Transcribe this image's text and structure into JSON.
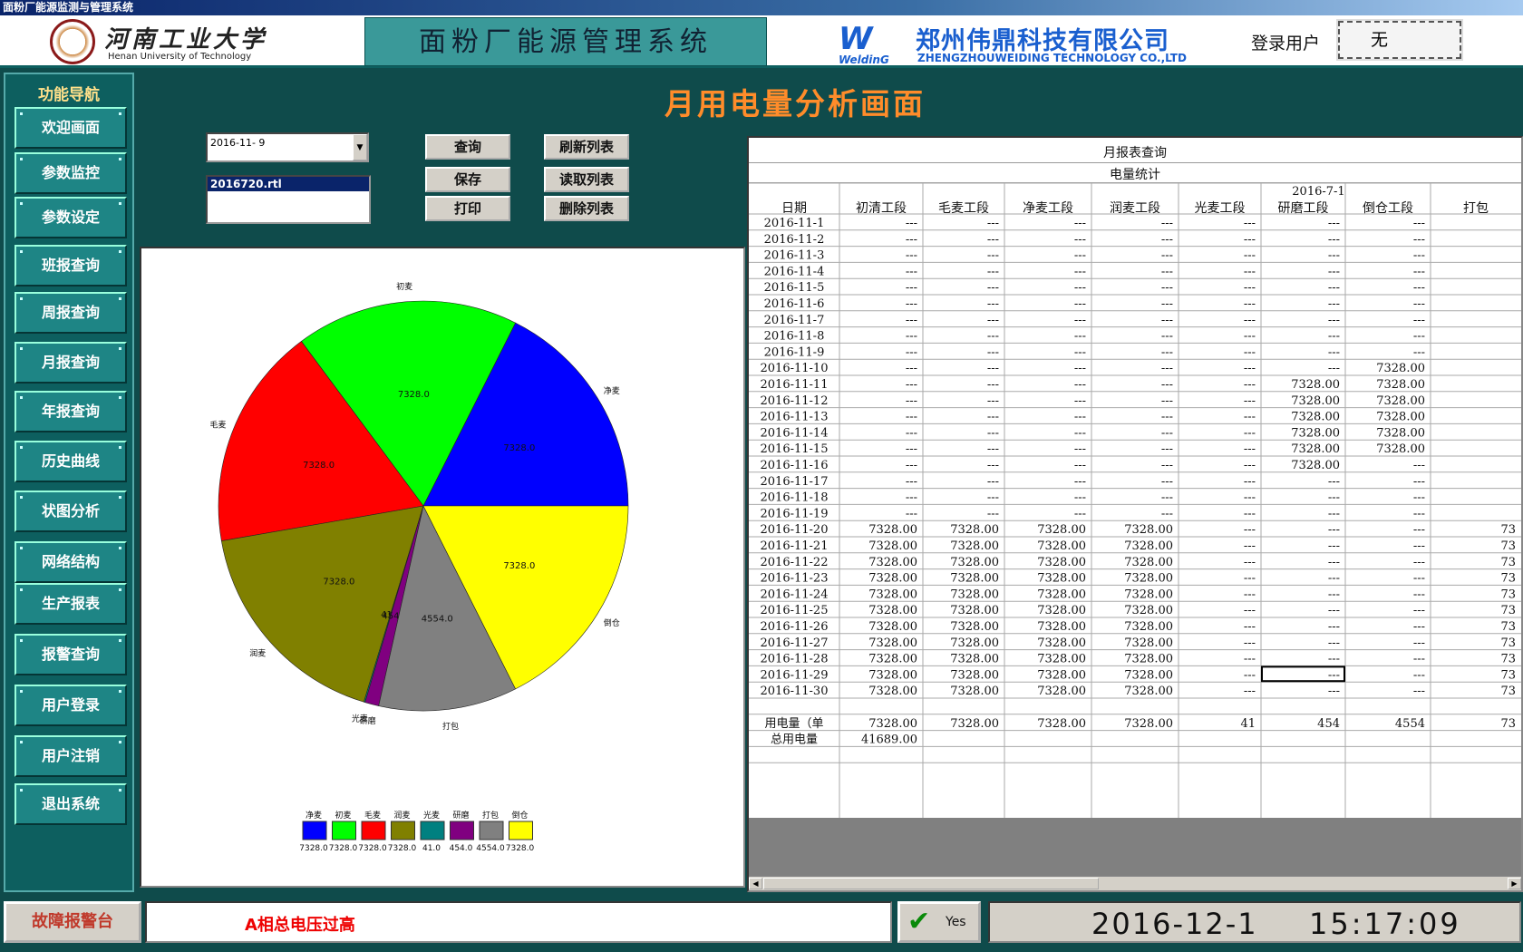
{
  "window_title": "面粉厂能源监测与管理系统",
  "header": {
    "univ_name": "河南工业大学",
    "univ_en": "Henan University of Technology",
    "system_title": "面粉厂能源管理系统",
    "company_logo_text": "WeldinG",
    "company_name": "郑州伟鼎科技有限公司",
    "company_en": "ZHENGZHOUWEIDING TECHNOLOGY CO.,LTD",
    "login_label": "登录用户",
    "login_user": "无"
  },
  "sidebar": {
    "title": "功能导航",
    "items": [
      {
        "label": "欢迎画面"
      },
      {
        "label": "参数监控"
      },
      {
        "label": "参数设定"
      },
      {
        "label": "班报查询"
      },
      {
        "label": "周报查询"
      },
      {
        "label": "月报查询"
      },
      {
        "label": "年报查询"
      },
      {
        "label": "历史曲线"
      },
      {
        "label": "状图分析"
      },
      {
        "label": "网络结构"
      },
      {
        "label": "生产报表"
      },
      {
        "label": "报警查询"
      },
      {
        "label": "用户登录"
      },
      {
        "label": "用户注销"
      },
      {
        "label": "退出系统"
      }
    ]
  },
  "main": {
    "page_title": "月用电量分析画面",
    "date_value": "2016-11- 9",
    "file_selected": "2016720.rtl",
    "buttons": {
      "query": "查询",
      "save": "保存",
      "print": "打印",
      "refresh": "刷新列表",
      "read": "读取列表",
      "delete": "删除列表"
    }
  },
  "chart_data": {
    "type": "pie",
    "categories": [
      "净麦",
      "初麦",
      "毛麦",
      "润麦",
      "光麦",
      "研磨",
      "打包",
      "倒仓"
    ],
    "values": [
      7328.0,
      7328.0,
      7328.0,
      7328.0,
      41.0,
      454.0,
      4554.0,
      7328.0
    ],
    "value_labels": [
      "7328.0",
      "7328.0",
      "7328.0",
      "7328.0",
      "41.0",
      "454.0",
      "4554.0",
      "7328.0"
    ],
    "colors": [
      "#0000ff",
      "#00ff00",
      "#ff0000",
      "#808000",
      "#008080",
      "#800080",
      "#808080",
      "#ffff00"
    ],
    "title": "",
    "legend": "bottom"
  },
  "report": {
    "title": "月报表查询",
    "subtitle": "电量统计",
    "period_label": "2016-7-1",
    "columns": [
      "日期",
      "初清工段",
      "毛麦工段",
      "净麦工段",
      "润麦工段",
      "光麦工段",
      "研磨工段",
      "倒仓工段",
      "打包"
    ],
    "rows": [
      [
        "2016-11-1",
        "---",
        "---",
        "---",
        "---",
        "---",
        "---",
        "---",
        ""
      ],
      [
        "2016-11-2",
        "---",
        "---",
        "---",
        "---",
        "---",
        "---",
        "---",
        ""
      ],
      [
        "2016-11-3",
        "---",
        "---",
        "---",
        "---",
        "---",
        "---",
        "---",
        ""
      ],
      [
        "2016-11-4",
        "---",
        "---",
        "---",
        "---",
        "---",
        "---",
        "---",
        ""
      ],
      [
        "2016-11-5",
        "---",
        "---",
        "---",
        "---",
        "---",
        "---",
        "---",
        ""
      ],
      [
        "2016-11-6",
        "---",
        "---",
        "---",
        "---",
        "---",
        "---",
        "---",
        ""
      ],
      [
        "2016-11-7",
        "---",
        "---",
        "---",
        "---",
        "---",
        "---",
        "---",
        ""
      ],
      [
        "2016-11-8",
        "---",
        "---",
        "---",
        "---",
        "---",
        "---",
        "---",
        ""
      ],
      [
        "2016-11-9",
        "---",
        "---",
        "---",
        "---",
        "---",
        "---",
        "---",
        ""
      ],
      [
        "2016-11-10",
        "---",
        "---",
        "---",
        "---",
        "---",
        "---",
        "7328.00",
        ""
      ],
      [
        "2016-11-11",
        "---",
        "---",
        "---",
        "---",
        "---",
        "7328.00",
        "7328.00",
        ""
      ],
      [
        "2016-11-12",
        "---",
        "---",
        "---",
        "---",
        "---",
        "7328.00",
        "7328.00",
        ""
      ],
      [
        "2016-11-13",
        "---",
        "---",
        "---",
        "---",
        "---",
        "7328.00",
        "7328.00",
        ""
      ],
      [
        "2016-11-14",
        "---",
        "---",
        "---",
        "---",
        "---",
        "7328.00",
        "7328.00",
        ""
      ],
      [
        "2016-11-15",
        "---",
        "---",
        "---",
        "---",
        "---",
        "7328.00",
        "7328.00",
        ""
      ],
      [
        "2016-11-16",
        "---",
        "---",
        "---",
        "---",
        "---",
        "7328.00",
        "---",
        ""
      ],
      [
        "2016-11-17",
        "---",
        "---",
        "---",
        "---",
        "---",
        "---",
        "---",
        ""
      ],
      [
        "2016-11-18",
        "---",
        "---",
        "---",
        "---",
        "---",
        "---",
        "---",
        ""
      ],
      [
        "2016-11-19",
        "---",
        "---",
        "---",
        "---",
        "---",
        "---",
        "---",
        ""
      ],
      [
        "2016-11-20",
        "7328.00",
        "7328.00",
        "7328.00",
        "7328.00",
        "---",
        "---",
        "---",
        "73"
      ],
      [
        "2016-11-21",
        "7328.00",
        "7328.00",
        "7328.00",
        "7328.00",
        "---",
        "---",
        "---",
        "73"
      ],
      [
        "2016-11-22",
        "7328.00",
        "7328.00",
        "7328.00",
        "7328.00",
        "---",
        "---",
        "---",
        "73"
      ],
      [
        "2016-11-23",
        "7328.00",
        "7328.00",
        "7328.00",
        "7328.00",
        "---",
        "---",
        "---",
        "73"
      ],
      [
        "2016-11-24",
        "7328.00",
        "7328.00",
        "7328.00",
        "7328.00",
        "---",
        "---",
        "---",
        "73"
      ],
      [
        "2016-11-25",
        "7328.00",
        "7328.00",
        "7328.00",
        "7328.00",
        "---",
        "---",
        "---",
        "73"
      ],
      [
        "2016-11-26",
        "7328.00",
        "7328.00",
        "7328.00",
        "7328.00",
        "---",
        "---",
        "---",
        "73"
      ],
      [
        "2016-11-27",
        "7328.00",
        "7328.00",
        "7328.00",
        "7328.00",
        "---",
        "---",
        "---",
        "73"
      ],
      [
        "2016-11-28",
        "7328.00",
        "7328.00",
        "7328.00",
        "7328.00",
        "---",
        "---",
        "---",
        "73"
      ],
      [
        "2016-11-29",
        "7328.00",
        "7328.00",
        "7328.00",
        "7328.00",
        "---",
        "---",
        "---",
        "73"
      ],
      [
        "2016-11-30",
        "7328.00",
        "7328.00",
        "7328.00",
        "7328.00",
        "---",
        "---",
        "---",
        "73"
      ],
      [
        "",
        "",
        "",
        "",
        "",
        "",
        "",
        "",
        ""
      ],
      [
        "用电量（单",
        "7328.00",
        "7328.00",
        "7328.00",
        "7328.00",
        "41",
        "454",
        "4554",
        "73"
      ],
      [
        "总用电量",
        "41689.00",
        "",
        "",
        "",
        "",
        "",
        "",
        ""
      ],
      [
        "",
        "",
        "",
        "",
        "",
        "",
        "",
        "",
        ""
      ],
      [
        "",
        "",
        "",
        "",
        "",
        "",
        "",
        "",
        ""
      ]
    ]
  },
  "status": {
    "alarm_label": "故障报警台",
    "alarm_text": "A相总电压过高",
    "ack_label": "Yes",
    "date": "2016-12-1",
    "time": "15:17:09"
  }
}
